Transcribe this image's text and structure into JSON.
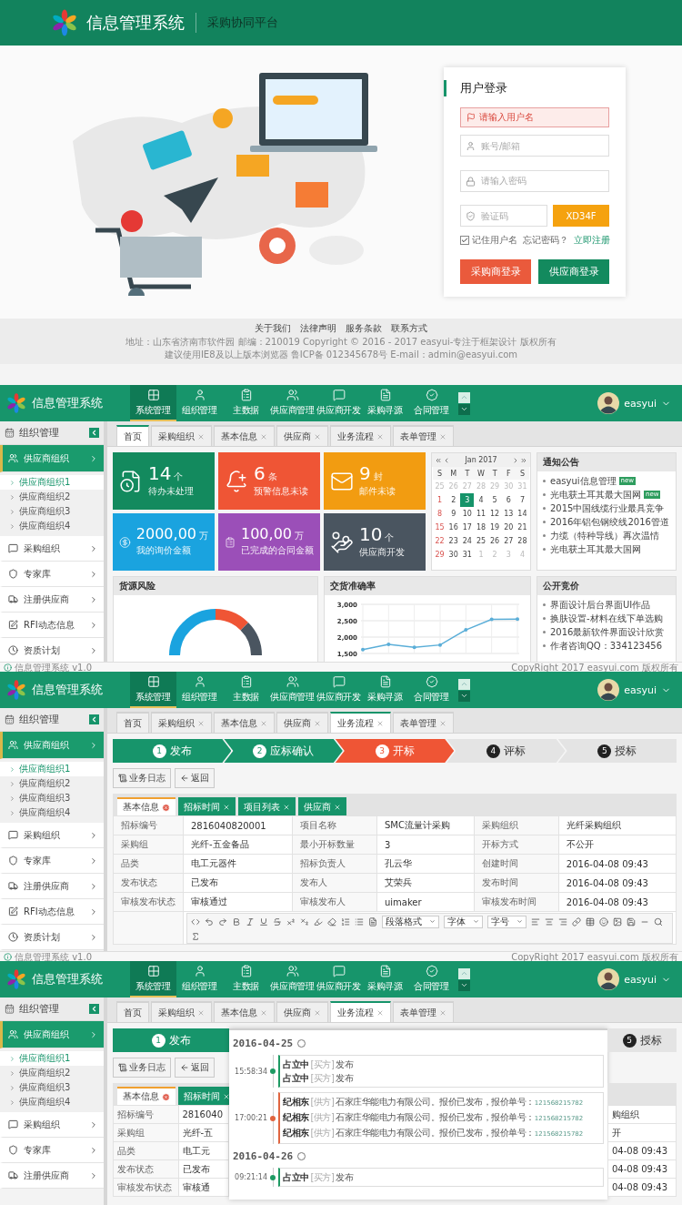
{
  "login": {
    "logo_text": "信息管理系统",
    "subtitle": "采购协同平台",
    "form": {
      "title": "用户登录",
      "error": "请输入用户名",
      "username": {
        "placeholder": "账号/邮箱"
      },
      "password": {
        "placeholder": "请输入密码"
      },
      "captcha": {
        "placeholder": "验证码",
        "code": "XD34F"
      },
      "remember": {
        "label": "记住用户名",
        "checked": true
      },
      "forgot": "忘记密码？",
      "register": "立即注册",
      "buttons": [
        {
          "label": "采购商登录",
          "kind": "buyer"
        },
        {
          "label": "供应商登录",
          "kind": "supplier"
        }
      ]
    },
    "footer": {
      "links": [
        "关于我们",
        "法律声明",
        "服务条款",
        "联系方式"
      ],
      "lines": [
        "地址：山东省济南市软件园 邮编：210019 Copyright © 2016 - 2017 easyui-专注于框架设计 版权所有",
        "建议使用IE8及以上版本浏览器 鲁ICP备 012345678号 E-mail：admin@easyui.com"
      ]
    }
  },
  "screens": [
    {
      "kind": "dashboard",
      "header": {
        "logo_text": "信息管理系统",
        "user": "easyui",
        "nav": [
          {
            "label": "系统管理",
            "selected": true
          },
          {
            "label": "组织管理",
            "selected": false
          },
          {
            "label": "主数据",
            "selected": false
          },
          {
            "label": "供应商管理",
            "selected": false
          },
          {
            "label": "供应商开发",
            "selected": false
          },
          {
            "label": "采购寻源",
            "selected": false
          },
          {
            "label": "合同管理",
            "selected": false
          }
        ]
      },
      "sidebar": {
        "title": "组织管理",
        "items": [
          {
            "label": "供应商组织",
            "selected": true,
            "children": [
              {
                "label": "供应商组织1",
                "selected": true
              },
              {
                "label": "供应商组织2",
                "selected": false
              },
              {
                "label": "供应商组织3",
                "selected": false
              },
              {
                "label": "供应商组织4",
                "selected": false
              }
            ]
          },
          {
            "label": "采购组织",
            "selected": false
          },
          {
            "label": "专家库",
            "selected": false
          },
          {
            "label": "注册供应商",
            "selected": false
          },
          {
            "label": "RFI动态信息",
            "selected": false
          },
          {
            "label": "资质计划",
            "selected": false
          }
        ]
      },
      "tabs": [
        {
          "label": "首页",
          "selected": true,
          "closable": false
        },
        {
          "label": "采购组织",
          "selected": false,
          "closable": true
        },
        {
          "label": "基本信息",
          "selected": false,
          "closable": true
        },
        {
          "label": "供应商",
          "selected": false,
          "closable": true
        },
        {
          "label": "业务流程",
          "selected": false,
          "closable": true
        },
        {
          "label": "表单管理",
          "selected": false,
          "closable": true
        }
      ],
      "dashboard": {
        "tiles": [
          {
            "kind": "tasks",
            "color": "#138a5e",
            "value": "14",
            "unit": "个",
            "label": "待办未处理"
          },
          {
            "kind": "alerts",
            "color": "#ef5535",
            "value": "6",
            "unit": "条",
            "label": "预警信息未读"
          },
          {
            "kind": "mail",
            "color": "#f29c11",
            "value": "9",
            "unit": "封",
            "label": "邮件未读"
          },
          {
            "kind": "inquiry",
            "color": "#1aa3df",
            "value": "2000,00",
            "unit": "万",
            "label": "我的询价金额"
          },
          {
            "kind": "contracts",
            "color": "#9b4fb8",
            "value": "100,00",
            "unit": "万",
            "label": "已完成的合同金额"
          },
          {
            "kind": "suppliers",
            "color": "#4a5560",
            "value": "10",
            "unit": "个",
            "label": "供应商开发"
          }
        ],
        "calendar": {
          "month": "Jan 2017",
          "weekdays": [
            "S",
            "M",
            "T",
            "W",
            "T",
            "F",
            "S"
          ],
          "weeks": [
            [
              {
                "day": "25",
                "outside": true,
                "selected": false
              },
              {
                "day": "26",
                "outside": true,
                "selected": false
              },
              {
                "day": "27",
                "outside": true,
                "selected": false
              },
              {
                "day": "28",
                "outside": true,
                "selected": false
              },
              {
                "day": "29",
                "outside": true,
                "selected": false
              },
              {
                "day": "30",
                "outside": true,
                "selected": false
              },
              {
                "day": "31",
                "outside": true,
                "selected": false
              }
            ],
            [
              {
                "day": "1",
                "outside": false,
                "selected": false
              },
              {
                "day": "2",
                "outside": false,
                "selected": false
              },
              {
                "day": "3",
                "outside": false,
                "selected": true
              },
              {
                "day": "4",
                "outside": false,
                "selected": false
              },
              {
                "day": "5",
                "outside": false,
                "selected": false
              },
              {
                "day": "6",
                "outside": false,
                "selected": false
              },
              {
                "day": "7",
                "outside": false,
                "selected": false
              }
            ],
            [
              {
                "day": "8",
                "outside": false,
                "selected": false
              },
              {
                "day": "9",
                "outside": false,
                "selected": false
              },
              {
                "day": "10",
                "outside": false,
                "selected": false
              },
              {
                "day": "11",
                "outside": false,
                "selected": false
              },
              {
                "day": "12",
                "outside": false,
                "selected": false
              },
              {
                "day": "13",
                "outside": false,
                "selected": false
              },
              {
                "day": "14",
                "outside": false,
                "selected": false
              }
            ],
            [
              {
                "day": "15",
                "outside": false,
                "selected": false
              },
              {
                "day": "16",
                "outside": false,
                "selected": false
              },
              {
                "day": "17",
                "outside": false,
                "selected": false
              },
              {
                "day": "18",
                "outside": false,
                "selected": false
              },
              {
                "day": "19",
                "outside": false,
                "selected": false
              },
              {
                "day": "20",
                "outside": false,
                "selected": false
              },
              {
                "day": "21",
                "outside": false,
                "selected": false
              }
            ],
            [
              {
                "day": "22",
                "outside": false,
                "selected": false
              },
              {
                "day": "23",
                "outside": false,
                "selected": false
              },
              {
                "day": "24",
                "outside": false,
                "selected": false
              },
              {
                "day": "25",
                "outside": false,
                "selected": false
              },
              {
                "day": "26",
                "outside": false,
                "selected": false
              },
              {
                "day": "27",
                "outside": false,
                "selected": false
              },
              {
                "day": "28",
                "outside": false,
                "selected": false
              }
            ],
            [
              {
                "day": "29",
                "outside": false,
                "selected": false
              },
              {
                "day": "30",
                "outside": false,
                "selected": false
              },
              {
                "day": "31",
                "outside": false,
                "selected": false
              },
              {
                "day": "1",
                "outside": true,
                "selected": false
              },
              {
                "day": "2",
                "outside": true,
                "selected": false
              },
              {
                "day": "3",
                "outside": true,
                "selected": false
              },
              {
                "day": "4",
                "outside": true,
                "selected": false
              }
            ]
          ]
        },
        "notices": {
          "title": "通知公告",
          "items": [
            {
              "text": "easyui信息管理",
              "badge": "new"
            },
            {
              "text": "光电获土耳其最大国网",
              "badge": "new"
            },
            {
              "text": "2015中国线缆行业最具竞争"
            },
            {
              "text": "2016年铝包钢绞线2016管道"
            },
            {
              "text": "力缆（特种导线）再次温情"
            },
            {
              "text": "光电获土耳其最大国网"
            }
          ]
        },
        "risk": {
          "title": "货源风险"
        },
        "delivery": {
          "title": "交货准确率",
          "chart_data": {
            "type": "line",
            "ylim": [
              1500,
              3000
            ],
            "yticks": [
              {
                "value": 1500,
                "label": "1,500"
              },
              {
                "value": 2000,
                "label": "2,000"
              },
              {
                "value": 2500,
                "label": "2,500"
              },
              {
                "value": 3000,
                "label": "3,000"
              }
            ],
            "grid": true,
            "series": [
              {
                "color": "#5aaed8",
                "values": [
                  1620,
                  1780,
                  1690,
                  1760,
                  2220,
                  2540,
                  2550
                ]
              }
            ]
          }
        },
        "bidding": {
          "title": "公开竞价",
          "items": [
            "界面设计后台界面UI作品",
            "换肤设置-材料在线下单选购",
            "2016最新软件界面设计欣赏",
            "作者咨询QQ：334123456"
          ]
        }
      },
      "status_bar": {
        "left": "信息管理系统 v1.0",
        "right": "CopyRight 2017 easyui.com 版权所有"
      }
    },
    {
      "kind": "workflow",
      "header": {
        "logo_text": "信息管理系统",
        "user": "easyui",
        "nav": [
          {
            "label": "系统管理",
            "selected": true
          },
          {
            "label": "组织管理",
            "selected": false
          },
          {
            "label": "主数据",
            "selected": false
          },
          {
            "label": "供应商管理",
            "selected": false
          },
          {
            "label": "供应商开发",
            "selected": false
          },
          {
            "label": "采购寻源",
            "selected": false
          },
          {
            "label": "合同管理",
            "selected": false
          }
        ]
      },
      "sidebar": {
        "title": "组织管理",
        "items": [
          {
            "label": "供应商组织",
            "selected": true,
            "children": [
              {
                "label": "供应商组织1",
                "selected": true
              },
              {
                "label": "供应商组织2",
                "selected": false
              },
              {
                "label": "供应商组织3",
                "selected": false
              },
              {
                "label": "供应商组织4",
                "selected": false
              }
            ]
          },
          {
            "label": "采购组织",
            "selected": false
          },
          {
            "label": "专家库",
            "selected": false
          },
          {
            "label": "注册供应商",
            "selected": false
          },
          {
            "label": "RFI动态信息",
            "selected": false
          },
          {
            "label": "资质计划",
            "selected": false
          }
        ]
      },
      "tabs": [
        {
          "label": "首页",
          "selected": false,
          "closable": false
        },
        {
          "label": "采购组织",
          "selected": false,
          "closable": true
        },
        {
          "label": "基本信息",
          "selected": false,
          "closable": true
        },
        {
          "label": "供应商",
          "selected": false,
          "closable": true
        },
        {
          "label": "业务流程",
          "selected": true,
          "closable": true
        },
        {
          "label": "表单管理",
          "selected": false,
          "closable": true
        }
      ],
      "workflow": {
        "steps": [
          {
            "number": "1",
            "label": "发布",
            "done": true,
            "current": false
          },
          {
            "number": "2",
            "label": "应标确认",
            "done": true,
            "current": false
          },
          {
            "number": "3",
            "label": "开标",
            "done": false,
            "current": true
          },
          {
            "number": "4",
            "label": "评标",
            "done": false,
            "current": false
          },
          {
            "number": "5",
            "label": "授标",
            "done": false,
            "current": false
          }
        ],
        "actions": [
          {
            "label": "业务日志",
            "kind": "log"
          },
          {
            "label": "返回",
            "kind": "back"
          }
        ],
        "subtabs": [
          {
            "label": "基本信息",
            "selected": true
          },
          {
            "label": "招标时间",
            "selected": false
          },
          {
            "label": "项目列表",
            "selected": false
          },
          {
            "label": "供应商",
            "selected": false
          }
        ],
        "rows": [
          [
            "招标编号",
            "2816040820001",
            "项目名称",
            "SMC流量计采购",
            "采购组织",
            "光纤采购组织"
          ],
          [
            "采购组",
            "光纤-五金备品",
            "最小开标数量",
            "3",
            "开标方式",
            "不公开"
          ],
          [
            "品类",
            "电工元器件",
            "招标负责人",
            "孔云华",
            "创建时间",
            "2016-04-08 09:43"
          ],
          [
            "发布状态",
            "已发布",
            "发布人",
            "艾荣兵",
            "发布时间",
            "2016-04-08 09:43"
          ],
          [
            "审核发布状态",
            "审核通过",
            "审核发布人",
            "uimaker",
            "审核发布时间",
            "2016-04-08 09:43"
          ]
        ],
        "editor": {
          "dropdowns": [
            "段落格式",
            "字体",
            "字号"
          ]
        }
      },
      "status_bar": {
        "left": "信息管理系统 v1.0",
        "right": "CopyRight 2017 easyui.com 版权所有"
      }
    },
    {
      "kind": "timeline",
      "header": {
        "logo_text": "信息管理系统",
        "user": "easyui",
        "nav": [
          {
            "label": "系统管理",
            "selected": true
          },
          {
            "label": "组织管理",
            "selected": false
          },
          {
            "label": "主数据",
            "selected": false
          },
          {
            "label": "供应商管理",
            "selected": false
          },
          {
            "label": "供应商开发",
            "selected": false
          },
          {
            "label": "采购寻源",
            "selected": false
          },
          {
            "label": "合同管理",
            "selected": false
          }
        ]
      },
      "sidebar": {
        "title": "组织管理",
        "items": [
          {
            "label": "供应商组织",
            "selected": true,
            "children": [
              {
                "label": "供应商组织1",
                "selected": true
              },
              {
                "label": "供应商组织2",
                "selected": false
              },
              {
                "label": "供应商组织3",
                "selected": false
              },
              {
                "label": "供应商组织4",
                "selected": false
              }
            ]
          },
          {
            "label": "采购组织",
            "selected": false
          },
          {
            "label": "专家库",
            "selected": false
          },
          {
            "label": "注册供应商",
            "selected": false
          }
        ]
      },
      "tabs": [
        {
          "label": "首页",
          "selected": false,
          "closable": false
        },
        {
          "label": "采购组织",
          "selected": false,
          "closable": true
        },
        {
          "label": "基本信息",
          "selected": false,
          "closable": true
        },
        {
          "label": "供应商",
          "selected": false,
          "closable": true
        },
        {
          "label": "业务流程",
          "selected": true,
          "closable": true
        },
        {
          "label": "表单管理",
          "selected": false,
          "closable": true
        }
      ],
      "timeline": {
        "left": {
          "step": {
            "number": "1",
            "label": "发布",
            "done": true,
            "current": false
          },
          "actions": [
            {
              "label": "业务日志",
              "kind": "log"
            },
            {
              "label": "返回",
              "kind": "back"
            }
          ],
          "subtabs": [
            {
              "label": "基本信息",
              "selected": true
            },
            {
              "label": "招标时间",
              "selected": false
            }
          ],
          "rows": [
            [
              "招标编号",
              "2816040"
            ],
            [
              "采购组",
              "光纤-五"
            ],
            [
              "品类",
              "电工元"
            ],
            [
              "发布状态",
              "已发布"
            ],
            [
              "审核发布状态",
              "审核通"
            ]
          ]
        },
        "dialog": {
          "groups": [
            {
              "date": "2016-04-25",
              "entries": [
                {
                  "time": "15:58:34",
                  "color": "#1e9a63",
                  "lines": [
                    {
                      "name": "占立中",
                      "role": "[买方]",
                      "text": "发布"
                    },
                    {
                      "name": "占立中",
                      "role": "[买方]",
                      "text": "发布"
                    }
                  ]
                },
                {
                  "time": "17:00:21",
                  "color": "#e0653f",
                  "lines": [
                    {
                      "name": "纪相东",
                      "role": "[供方]",
                      "text": "石家庄华能电力有限公司。报价已发布，报价单号：",
                      "number": "121568215782"
                    },
                    {
                      "name": "纪相东",
                      "role": "[供方]",
                      "text": "石家庄华能电力有限公司。报价已发布，报价单号：",
                      "number": "121568215782"
                    },
                    {
                      "name": "纪相东",
                      "role": "[供方]",
                      "text": "石家庄华能电力有限公司。报价已发布，报价单号：",
                      "number": "121568215782"
                    }
                  ]
                }
              ]
            },
            {
              "date": "2016-04-26",
              "entries": [
                {
                  "time": "09:21:14",
                  "color": "#1e9a63",
                  "lines": [
                    {
                      "name": "占立中",
                      "role": "[买方]",
                      "text": "发布"
                    }
                  ]
                }
              ]
            }
          ]
        },
        "right": {
          "step": {
            "number": "5",
            "label": "授标",
            "done": false,
            "current": false
          },
          "cells": [
            "购组织",
            "开",
            "04-08 09:43",
            "04-08 09:43",
            "04-08 09:43"
          ]
        }
      }
    }
  ]
}
